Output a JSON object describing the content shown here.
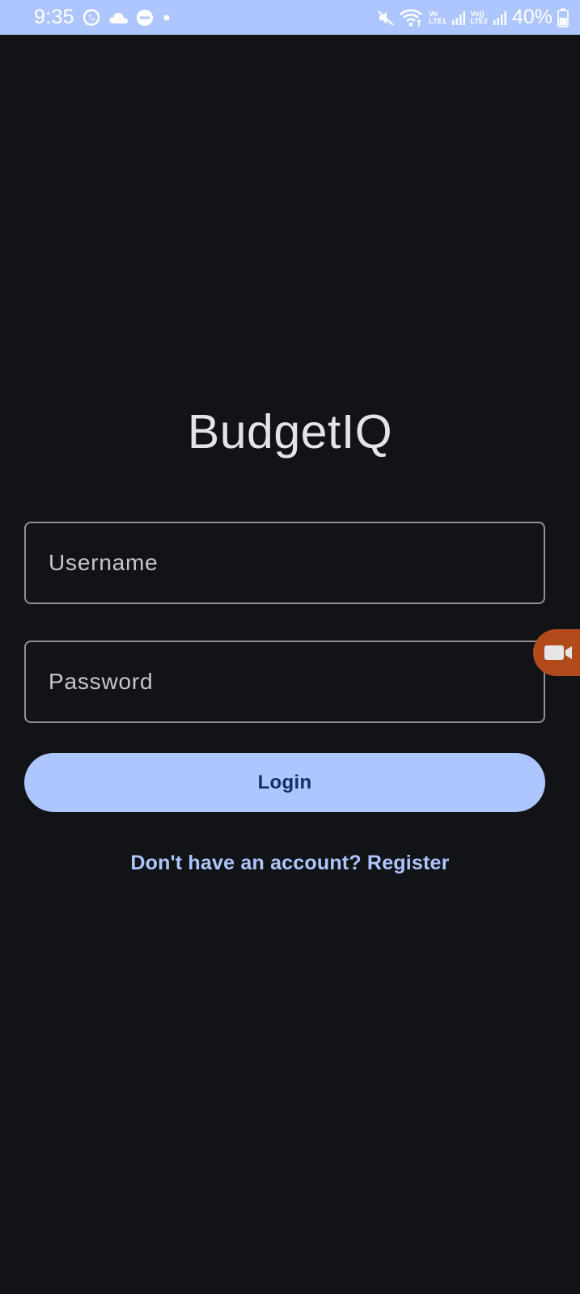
{
  "status_bar": {
    "time": "9:35",
    "left_icons": [
      "whatsapp-icon",
      "cloud-icon",
      "do-not-disturb-icon",
      "dot-icon"
    ],
    "right_icons": [
      "mute-icon",
      "wifi-icon",
      "signal-icon",
      "signal-icon"
    ],
    "sim1_label_top": "Vo",
    "sim1_label_bottom": "LTE1",
    "sim2_label_top": "Vo))",
    "sim2_label_bottom": "LTE2",
    "battery_percent": "40%",
    "bar_color": "#aec6ff"
  },
  "app": {
    "title": "BudgetIQ"
  },
  "login_form": {
    "username_placeholder": "Username",
    "username_value": "",
    "password_placeholder": "Password",
    "password_value": "",
    "login_label": "Login",
    "register_prompt": "Don't have an account? Register"
  },
  "overlay": {
    "floating_bubble_icon": "video-camera-icon",
    "bubble_color": "#b34a1c"
  },
  "colors": {
    "background": "#121317",
    "accent": "#aec6ff",
    "button_text": "#102f60",
    "field_border": "#8e9099",
    "title_text": "#e3e3e8"
  }
}
